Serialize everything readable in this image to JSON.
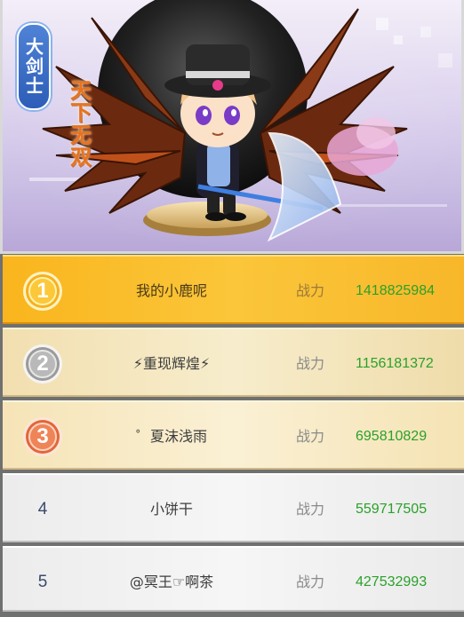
{
  "banner": {
    "class_tag": "大剑士",
    "title_art": "天下无双",
    "colors": {
      "class_tag": "#3f70c8",
      "title_art": "#e7731f"
    }
  },
  "power_label": "战力",
  "ranking": [
    {
      "rank": "1",
      "name": "我的小鹿呢",
      "power": "1418825984",
      "medal": "gold-medal-icon"
    },
    {
      "rank": "2",
      "name": "⚡重现辉煌⚡",
      "power": "1156181372",
      "medal": "silver-medal-icon"
    },
    {
      "rank": "3",
      "name": "゜夏沫浅雨",
      "power": "695810829",
      "medal": "bronze-medal-icon"
    },
    {
      "rank": "4",
      "name": "小饼干",
      "power": "559717505"
    },
    {
      "rank": "5",
      "name": "@冥王☞啊茶",
      "power": "427532993"
    }
  ],
  "colors": {
    "power_value": "#2aa12a",
    "power_label": "#8a8a8a",
    "rank1_bg": "#f9b51d"
  }
}
